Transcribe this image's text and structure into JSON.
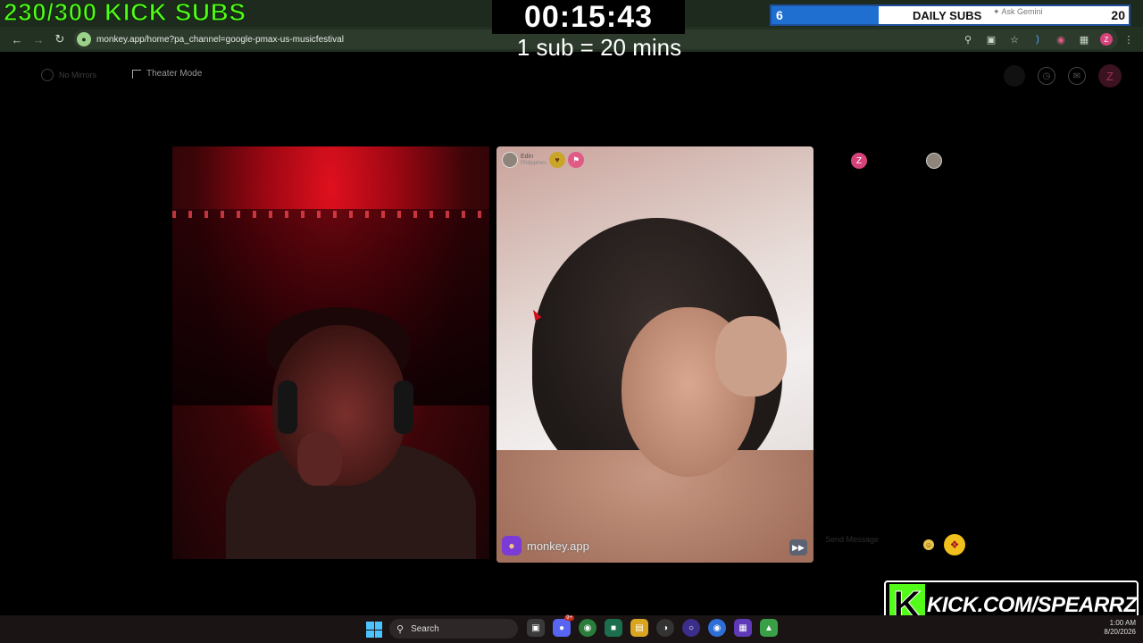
{
  "overlay": {
    "kick_goal": "230/300 KICK SUBS",
    "timer": "00:15:43",
    "sub_rate": "1 sub = 20 mins",
    "daily_subs": {
      "current": "6",
      "label": "DAILY SUBS",
      "goal": "20",
      "progress": 0.3
    },
    "kick_handle_letter": "K",
    "kick_handle_url": "KICK.COM/SPEARRZ"
  },
  "browser": {
    "url": "monkey.app/home?pa_channel=google-pmax-us-musicfestival",
    "ask_gemini": "✦ Ask Gemini",
    "profile_letter": "Z"
  },
  "app": {
    "no_mirrors_label": "No Mirrors",
    "theater_mode_label": "Theater Mode",
    "avatar_letter": "Z",
    "peer": {
      "name": "Edin",
      "country": "Philippines"
    },
    "brand": "monkey.app",
    "chat": {
      "self_letter": "Z",
      "send_placeholder": "Send Message"
    }
  },
  "taskbar": {
    "search_label": "Search",
    "discord_badge": "9+",
    "time": "1:00 AM",
    "date": "8/20/2026"
  }
}
